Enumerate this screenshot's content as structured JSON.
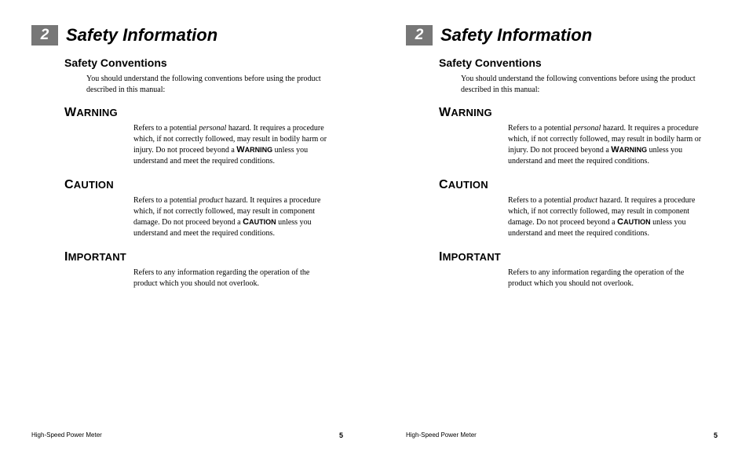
{
  "chapter": {
    "number": "2",
    "title": "Safety Information"
  },
  "section": {
    "title": "Safety Conventions",
    "intro": "You should understand the following conventions before using the product described in this manual:"
  },
  "callouts": {
    "warning": {
      "label_first": "W",
      "label_rest": "ARNING",
      "body_a": "Refers to a potential ",
      "body_em": "personal",
      "body_b": " hazard. It requires a procedure which, if not correctly followed, may result in bodily harm or injury. Do not proceed beyond a ",
      "inline_first": "W",
      "inline_rest": "ARNING",
      "body_c": " unless you understand and meet the required conditions."
    },
    "caution": {
      "label_first": "C",
      "label_rest": "AUTION",
      "body_a": "Refers to a potential ",
      "body_em": "product",
      "body_b": " hazard. It requires a procedure which, if not correctly followed, may result in component damage. Do not proceed beyond a ",
      "inline_first": "C",
      "inline_rest": "AUTION",
      "body_c": " unless you understand and meet the required conditions."
    },
    "important": {
      "label_first": "I",
      "label_rest": "MPORTANT",
      "body": "Refers to any information regarding the operation of the product which you should not overlook."
    }
  },
  "footer": {
    "product": "High-Speed Power Meter",
    "page_number": "5"
  }
}
